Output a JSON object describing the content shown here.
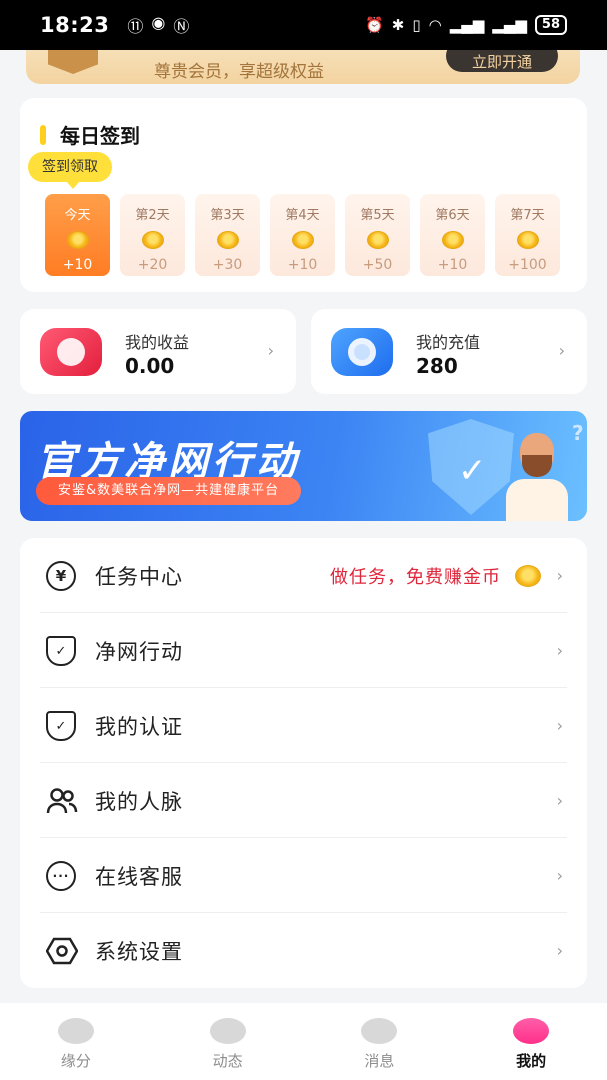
{
  "status_bar": {
    "time": "18:23",
    "battery": "58"
  },
  "vip": {
    "text": "尊贵会员，享超级权益",
    "button": "立即开通"
  },
  "sign_in": {
    "title": "每日签到",
    "tip": "签到领取",
    "days": [
      {
        "label": "今天",
        "value": "+10",
        "today": true
      },
      {
        "label": "第2天",
        "value": "+20"
      },
      {
        "label": "第3天",
        "value": "+30"
      },
      {
        "label": "第4天",
        "value": "+10"
      },
      {
        "label": "第5天",
        "value": "+50"
      },
      {
        "label": "第6天",
        "value": "+10"
      },
      {
        "label": "第7天",
        "value": "+100"
      }
    ]
  },
  "income": {
    "label": "我的收益",
    "value": "0.00"
  },
  "recharge": {
    "label": "我的充值",
    "value": "280"
  },
  "banner": {
    "title": "官方净网行动",
    "subtitle": "安鉴&数美联合净网—共建健康平台"
  },
  "menu": {
    "items": [
      {
        "label": "任务中心",
        "extra": "做任务，免费赚金币",
        "icon": "yen-coin-icon"
      },
      {
        "label": "净网行动",
        "icon": "shield-check-icon"
      },
      {
        "label": "我的认证",
        "icon": "shield-check-icon"
      },
      {
        "label": "我的人脉",
        "icon": "people-icon"
      },
      {
        "label": "在线客服",
        "icon": "chat-bubble-icon"
      },
      {
        "label": "系统设置",
        "icon": "settings-icon"
      }
    ]
  },
  "tabbar": {
    "tabs": [
      {
        "label": "缘分"
      },
      {
        "label": "动态"
      },
      {
        "label": "消息"
      },
      {
        "label": "我的",
        "active": true
      }
    ]
  }
}
